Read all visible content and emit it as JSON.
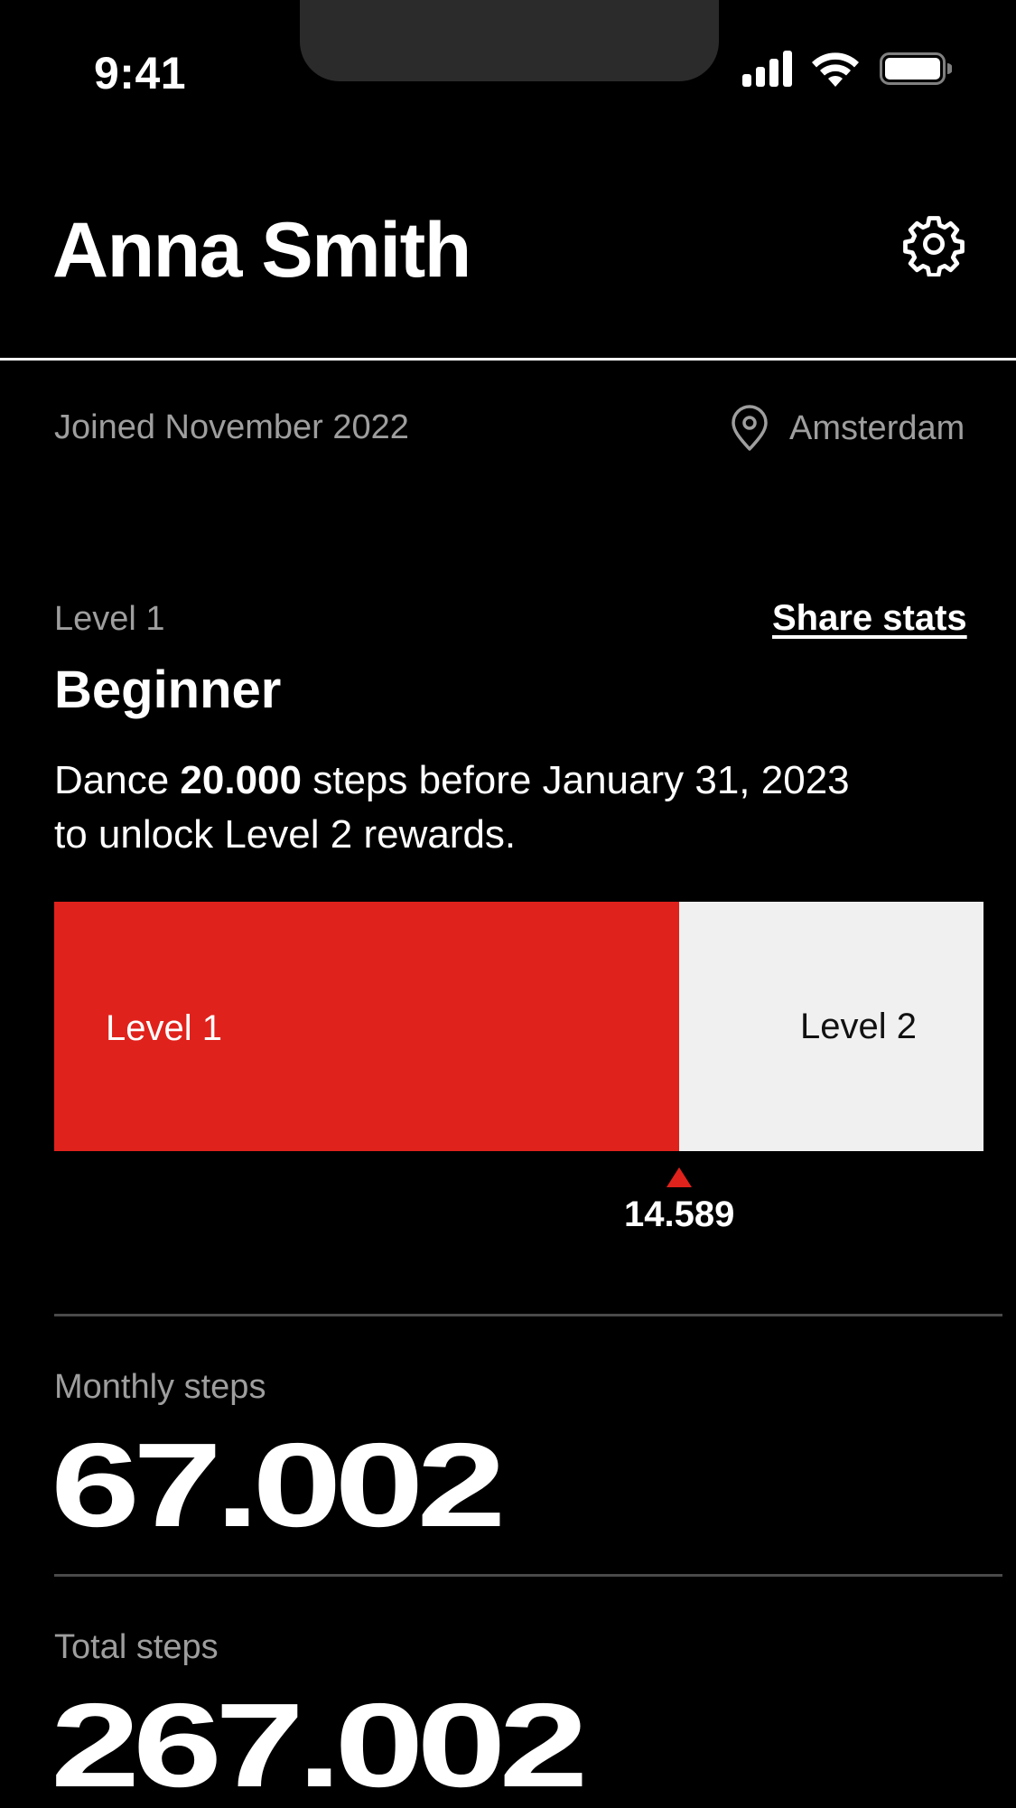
{
  "status_bar": {
    "time": "9:41"
  },
  "header": {
    "title": "Anna Smith"
  },
  "profile": {
    "joined": "Joined November 2022",
    "location": "Amsterdam"
  },
  "level": {
    "label": "Level 1",
    "share_label": "Share stats",
    "name": "Beginner",
    "description_before": "Dance ",
    "description_bold": "20.000",
    "description_after": " steps before January 31, 2023 to unlock Level 2 rewards."
  },
  "progress": {
    "current_level_label": "Level 1",
    "next_level_label": "Level 2",
    "current_steps": "14.589",
    "fraction": 0.6727
  },
  "stats": [
    {
      "label": "Monthly steps",
      "value": "67.002"
    },
    {
      "label": "Total steps",
      "value": "267.002"
    }
  ],
  "colors": {
    "accent": "#e0221c",
    "background": "#000000",
    "muted": "#9e9e9e",
    "track": "#f0f0f0"
  },
  "icons": {
    "settings": "gear-icon",
    "location": "map-pin-icon"
  }
}
